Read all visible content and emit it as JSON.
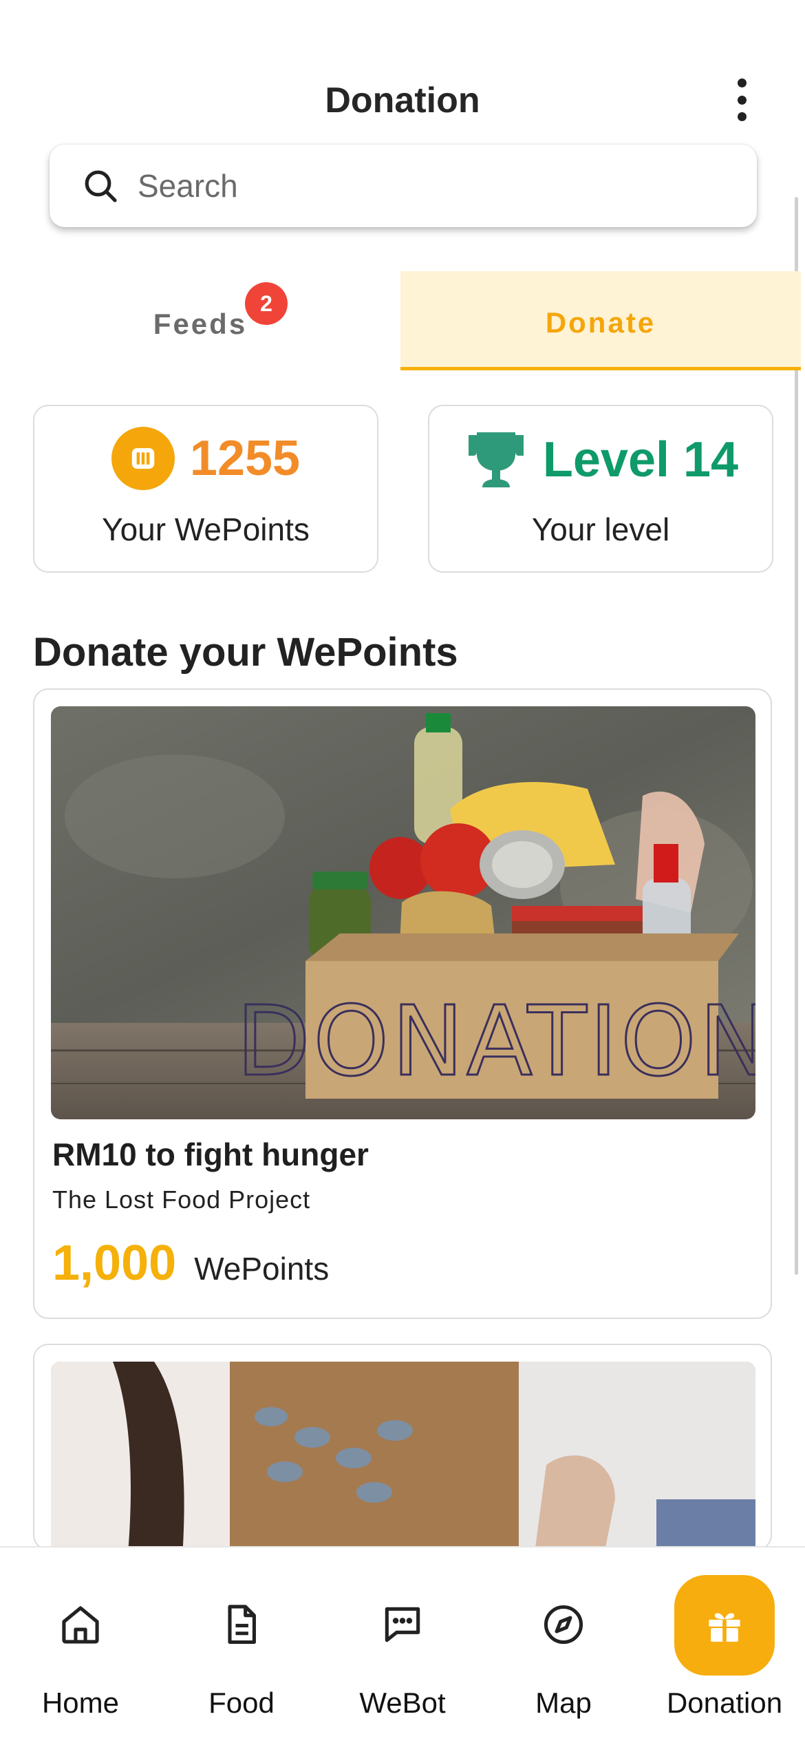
{
  "header": {
    "title": "Donation",
    "more_icon": "more-vertical-icon"
  },
  "search": {
    "placeholder": "Search",
    "value": "",
    "icon": "search-icon"
  },
  "tabs": [
    {
      "label": "Feeds",
      "badge": "2",
      "active": false
    },
    {
      "label": "Donate",
      "active": true
    }
  ],
  "stats": {
    "points": {
      "value": "1255",
      "caption": "Your WePoints",
      "icon": "wepoints-coin-icon"
    },
    "level": {
      "value": "Level 14",
      "caption": "Your level",
      "icon": "trophy-icon"
    }
  },
  "section": {
    "title": "Donate your WePoints"
  },
  "donations": [
    {
      "title": "RM10 to fight hunger",
      "org": "The Lost Food Project",
      "cost": "1,000",
      "unit": "WePoints",
      "image_text": "DONATION"
    },
    {
      "title": "",
      "org": "",
      "cost": "",
      "unit": ""
    }
  ],
  "bottom_nav": [
    {
      "label": "Home",
      "icon": "home-icon",
      "active": false
    },
    {
      "label": "Food",
      "icon": "document-icon",
      "active": false
    },
    {
      "label": "WeBot",
      "icon": "chat-icon",
      "active": false
    },
    {
      "label": "Map",
      "icon": "compass-icon",
      "active": false
    },
    {
      "label": "Donation",
      "icon": "gift-icon",
      "active": true
    }
  ],
  "colors": {
    "accent": "#f5b00a",
    "points": "#f28c28",
    "level": "#0e9a69",
    "badge": "#f04438",
    "tab_active_bg": "#fff3d6"
  }
}
